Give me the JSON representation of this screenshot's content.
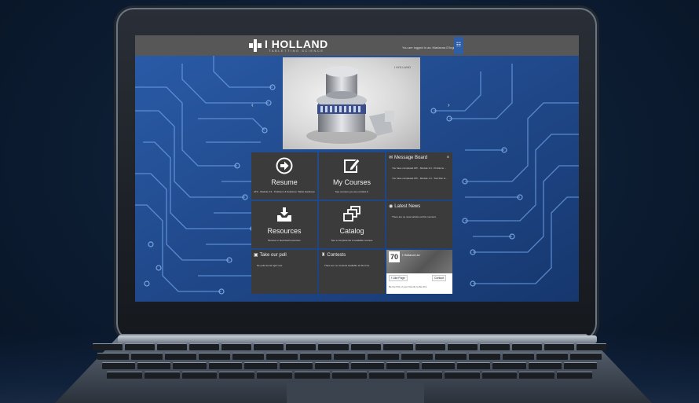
{
  "header": {
    "logo_text": "I HOLLAND",
    "logo_sub": "TABLETTING SCIENCE",
    "logged_in_text": "You are logged in as: Marianna D'Ingiho",
    "menu_icon": "menu-icon"
  },
  "hero": {
    "logo_text": "I HOLLAND",
    "prev_arrow": "‹",
    "next_arrow": "›"
  },
  "tiles": {
    "resume": {
      "title": "Resume",
      "subtitle": "ATF - Module 3.3 - Problems & Solutions: Tablet Hardness",
      "icon": "arrow-circle-icon"
    },
    "my_courses": {
      "title": "My Courses",
      "subtitle": "See courses you are enrolled in",
      "icon": "edit-icon"
    },
    "resources": {
      "title": "Resources",
      "subtitle": "Browse or download resources",
      "icon": "download-tray-icon"
    },
    "catalog": {
      "title": "Catalog",
      "subtitle": "See a complete list of available courses",
      "icon": "stack-icon"
    }
  },
  "message_board": {
    "title": "Message Board",
    "items": [
      "You have completed ATF - Module 3.3 - Problems ...",
      "You have completed ATF - Module 1.3 - Tool Run H..."
    ]
  },
  "latest_news": {
    "title": "Latest News",
    "text": "There are no news articles at this moment."
  },
  "poll": {
    "title": "Take our poll",
    "text": "No polls found right now."
  },
  "contests": {
    "title": "Contests",
    "text": "There are no contests available at this time."
  },
  "facebook": {
    "page_name": "I Holland Ltd",
    "like_label": "Like Page",
    "contact_label": "Contact",
    "footer_text": "Be the first of your friends to like this"
  },
  "colors": {
    "screen_blue": "#1a3d77",
    "tile_dark": "#3b3b3b",
    "header_gray": "#575757",
    "accent_blue": "#2f5ea8"
  }
}
